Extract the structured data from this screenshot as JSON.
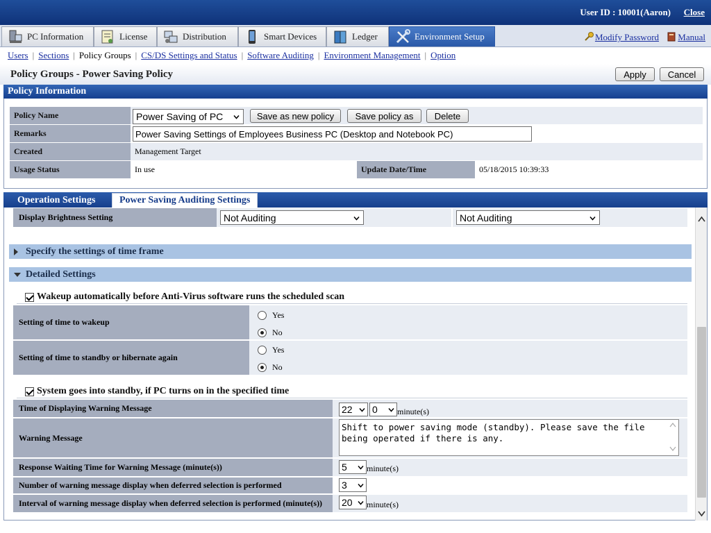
{
  "header": {
    "user_id": "User ID : 10001(Aaron)",
    "close": "Close"
  },
  "main_tabs": [
    {
      "label": "PC Information"
    },
    {
      "label": "License"
    },
    {
      "label": "Distribution"
    },
    {
      "label": "Smart Devices"
    },
    {
      "label": "Ledger"
    },
    {
      "label": "Environment Setup"
    }
  ],
  "top_links": {
    "modify_password": "Modify Password",
    "manual": "Manual"
  },
  "subnav": [
    "Users",
    "Sections",
    "Policy Groups",
    "CS/DS Settings and Status",
    "Software Auditing",
    "Environment Management",
    "Option"
  ],
  "page_title": "Policy Groups - Power Saving Policy",
  "buttons": {
    "apply": "Apply",
    "cancel": "Cancel",
    "save_new": "Save as new policy",
    "save_as": "Save policy as",
    "delete": "Delete"
  },
  "policy_info": {
    "heading": "Policy Information",
    "policy_name_label": "Policy Name",
    "policy_name_value": "Power Saving of PC",
    "remarks_label": "Remarks",
    "remarks_value": "Power Saving Settings of Employees Business PC (Desktop and Notebook PC)",
    "created_label": "Created",
    "created_value": "Management Target",
    "usage_label": "Usage Status",
    "usage_value": "In use",
    "update_label": "Update Date/Time",
    "update_value": "05/18/2015 10:39:33"
  },
  "lower_tabs": {
    "operation": "Operation Settings",
    "auditing": "Power Saving Auditing Settings"
  },
  "brightness": {
    "label": "Display Brightness Setting",
    "left_value": "Not Auditing",
    "right_value": "Not Auditing"
  },
  "time_frame": {
    "label": "Specify the settings of time frame"
  },
  "detailed": {
    "label": "Detailed Settings",
    "wakeup_check": "Wakeup automatically before Anti-Virus software runs the scheduled scan",
    "wakeup_time_label": "Setting of time to wakeup",
    "standby_again_label": "Setting of time to standby or hibernate again",
    "yes": "Yes",
    "no": "No",
    "standby_check": "System goes into standby, if PC turns on in the specified time",
    "warn_time_label": "Time of Displaying Warning Message",
    "warn_hour": "22",
    "warn_minute": "0",
    "unit_minutes": "minute(s)",
    "warn_msg_label": "Warning Message",
    "warn_msg_value": "Shift to power saving mode (standby). Please save the file being operated if there is any.",
    "response_label": "Response Waiting Time for Warning Message (minute(s))",
    "response_value": "5",
    "count_label": "Number of warning message display when deferred selection is performed",
    "count_value": "3",
    "interval_label": "Interval of warning message display when deferred selection is performed (minute(s))",
    "interval_value": "20"
  },
  "colors": {
    "header_blue": "#16408f",
    "tab_active": "#2a59a8",
    "label_gray": "#a5adbe",
    "link": "#1a2fa0",
    "collapse_bar": "#a9c3e3"
  }
}
